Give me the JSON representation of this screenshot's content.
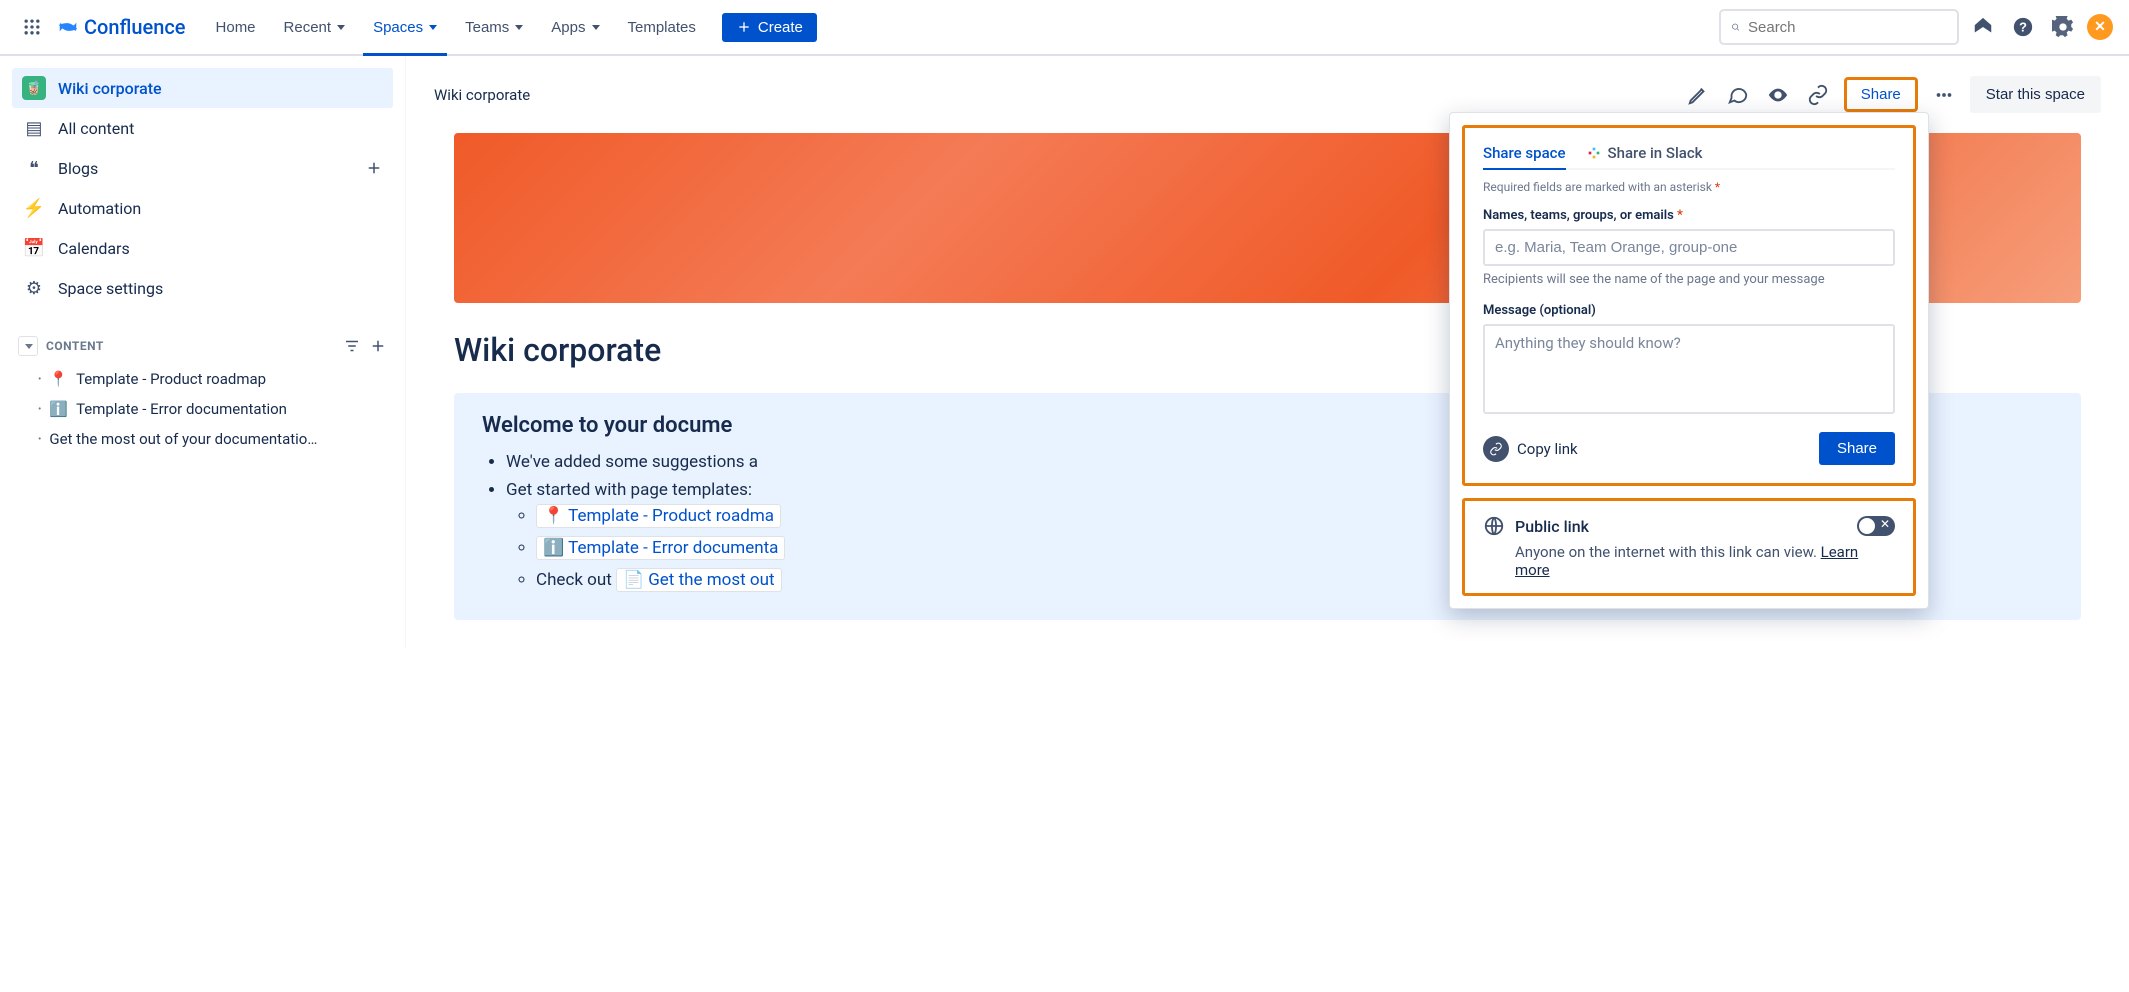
{
  "product": "Confluence",
  "nav": {
    "home": "Home",
    "recent": "Recent",
    "spaces": "Spaces",
    "teams": "Teams",
    "apps": "Apps",
    "templates": "Templates",
    "create": "Create"
  },
  "search": {
    "placeholder": "Search"
  },
  "sidebar": {
    "space": "Wiki corporate",
    "items": [
      {
        "label": "All content"
      },
      {
        "label": "Blogs"
      },
      {
        "label": "Automation"
      },
      {
        "label": "Calendars"
      },
      {
        "label": "Space settings"
      }
    ],
    "section": "CONTENT",
    "tree": [
      {
        "icon": "📍",
        "label": "Template - Product roadmap"
      },
      {
        "icon": "ℹ️",
        "label": "Template - Error documentation"
      },
      {
        "icon": "",
        "label": "Get the most out of your documentatio…"
      }
    ]
  },
  "page": {
    "breadcrumb": "Wiki corporate",
    "share_btn": "Share",
    "star_btn": "Star this space",
    "title": "Wiki corporate",
    "welcome": {
      "heading": "Welcome to your docume",
      "b1": "We've added some suggestions a",
      "b2": "Get started with page templates:",
      "l1": "Template - Product roadma",
      "l2": "Template - Error documenta",
      "b3": "Check out ",
      "l3": "Get the most out"
    }
  },
  "share": {
    "tab1": "Share space",
    "tab2": "Share in Slack",
    "required_note": "Required fields are marked with an asterisk",
    "names_label": "Names, teams, groups, or emails",
    "names_placeholder": "e.g. Maria, Team Orange, group-one",
    "names_help": "Recipients will see the name of the page and your message",
    "message_label": "Message (optional)",
    "message_placeholder": "Anything they should know?",
    "copy_link": "Copy link",
    "share_action": "Share",
    "public_title": "Public link",
    "public_desc": "Anyone on the internet with this link can view. ",
    "learn_more": "Learn more"
  }
}
